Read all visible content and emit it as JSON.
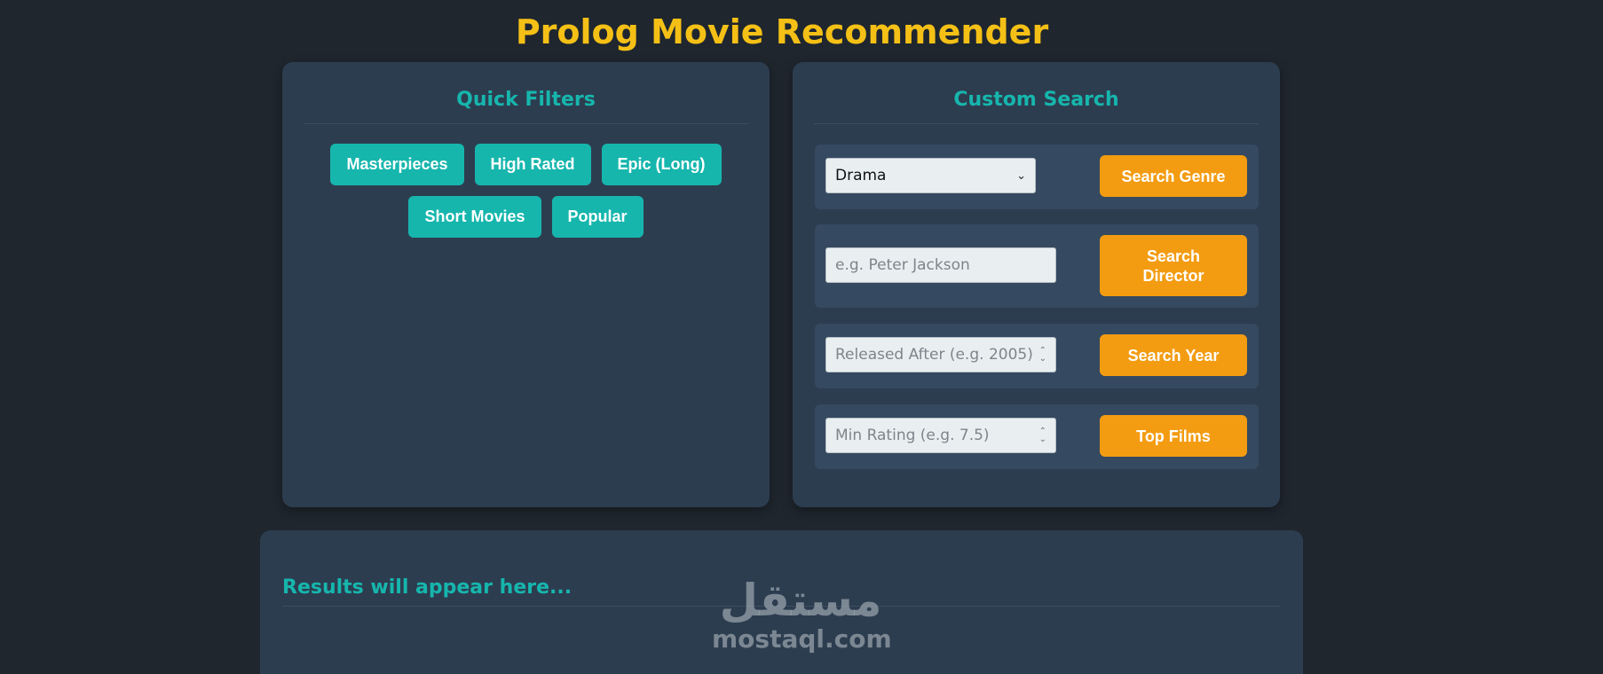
{
  "app": {
    "title": "Prolog Movie Recommender"
  },
  "quick_filters": {
    "heading": "Quick Filters",
    "buttons": [
      "Masterpieces",
      "High Rated",
      "Epic (Long)",
      "Short Movies",
      "Popular"
    ]
  },
  "custom_search": {
    "heading": "Custom Search",
    "genre": {
      "selected": "Drama",
      "button": "Search Genre"
    },
    "director": {
      "placeholder": "e.g. Peter Jackson",
      "button": "Search Director"
    },
    "year": {
      "placeholder": "Released After (e.g. 2005)",
      "button": "Search Year"
    },
    "rating": {
      "placeholder": "Min Rating (e.g. 7.5)",
      "button": "Top Films"
    }
  },
  "results": {
    "heading": "Results will appear here..."
  },
  "watermark": {
    "arabic": "مستقل",
    "latin": "mostaql.com"
  },
  "colors": {
    "background": "#1f262e",
    "card": "#2d3d50",
    "accent_teal": "#16b6ad",
    "accent_orange": "#f39c12",
    "title_yellow": "#f5c016"
  }
}
